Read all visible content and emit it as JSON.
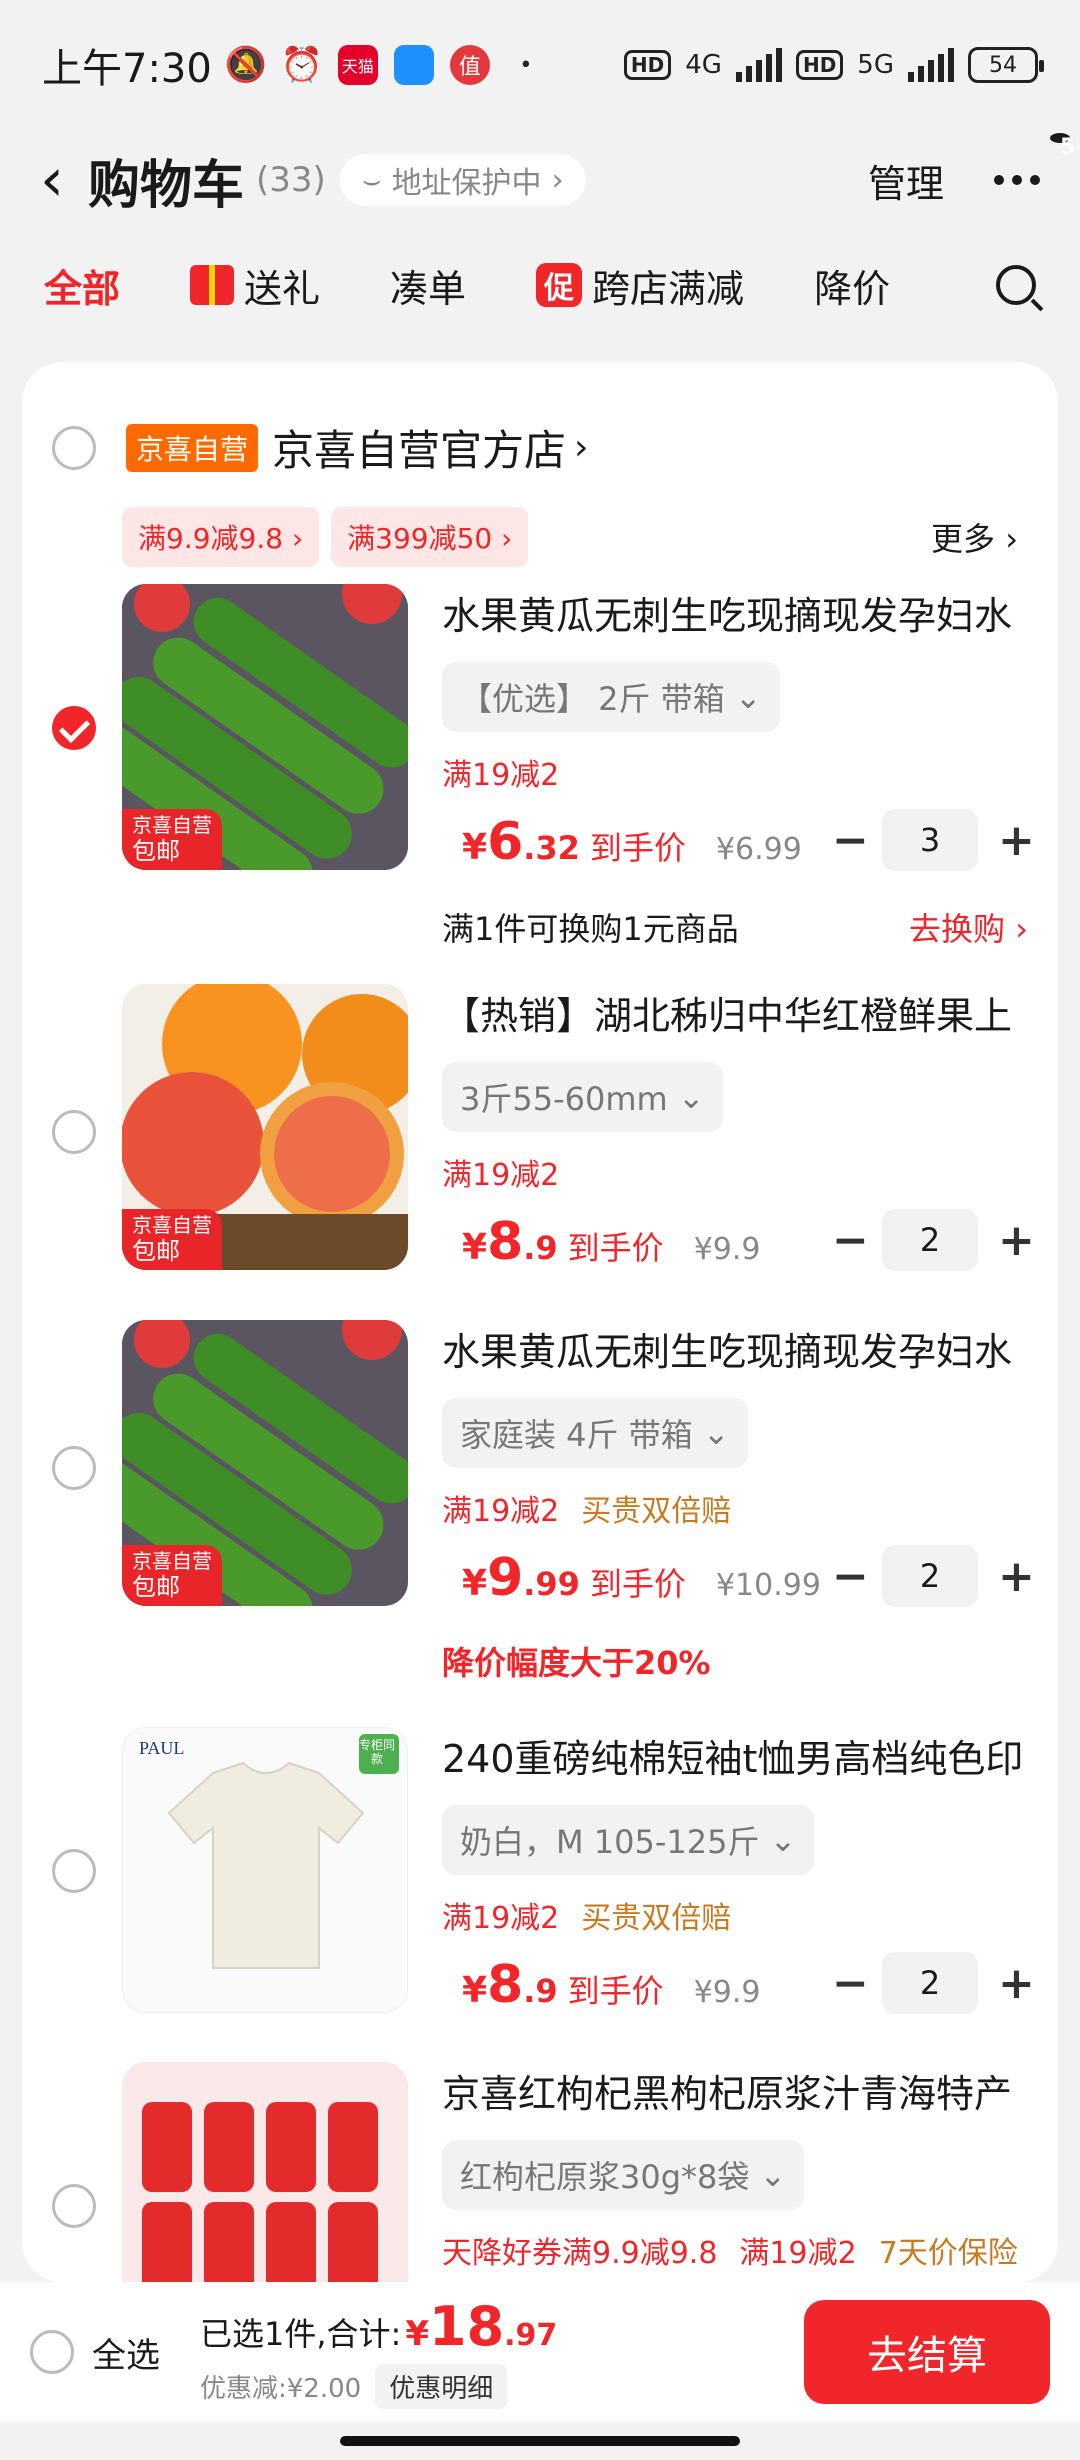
{
  "status_bar": {
    "time": "上午7:30",
    "net1": "4G",
    "net2": "5G",
    "hd": "HD",
    "battery": "54",
    "app_icon_1": "天猫",
    "app_icon_3": "值"
  },
  "header": {
    "title": "购物车",
    "count": "(33)",
    "address_pill": "地址保护中",
    "manage": "管理",
    "badge": "5+"
  },
  "tabs": [
    "全部",
    "送礼",
    "凑单",
    "跨店满减",
    "降价"
  ],
  "tab_icons": {
    "promo_mark": "促"
  },
  "store": {
    "tag": "京喜自营",
    "name": "京喜自营官方店",
    "promos": [
      "满9.9减9.8 ›",
      "满399减50 ›"
    ],
    "more": "更多 ›"
  },
  "items": [
    {
      "name": "水果黄瓜无刺生吃现摘现发孕妇水",
      "spec": "【优选】 2斤 带箱",
      "tags": [
        "满19减2"
      ],
      "price_int": "6",
      "price_dec": ".32",
      "dao": "到手价",
      "orig": "¥6.99",
      "qty": "3",
      "checked": true,
      "thumb_label_1": "京喜自营",
      "thumb_label_2": "包邮",
      "exchange_text": "满1件可换购1元商品",
      "exchange_link": "去换购 ›"
    },
    {
      "name": "【热销】湖北秭归中华红橙鲜果上",
      "spec": "3斤55-60mm",
      "tags": [
        "满19减2"
      ],
      "price_int": "8",
      "price_dec": ".9",
      "dao": "到手价",
      "orig": "¥9.9",
      "qty": "2",
      "checked": false,
      "thumb_label_1": "京喜自营",
      "thumb_label_2": "包邮"
    },
    {
      "name": "水果黄瓜无刺生吃现摘现发孕妇水",
      "spec": "家庭装 4斤 带箱",
      "tags": [
        "满19减2",
        "买贵双倍赔"
      ],
      "price_int": "9",
      "price_dec": ".99",
      "dao": "到手价",
      "orig": "¥10.99",
      "qty": "2",
      "checked": false,
      "thumb_label_1": "京喜自营",
      "thumb_label_2": "包邮",
      "drop_text": "降价幅度大于20%"
    },
    {
      "name": "240重磅纯棉短袖t恤男高档纯色印",
      "spec": "奶白，M 105-125斤",
      "tags": [
        "满19减2",
        "买贵双倍赔"
      ],
      "price_int": "8",
      "price_dec": ".9",
      "dao": "到手价",
      "orig": "¥9.9",
      "qty": "2",
      "checked": false,
      "brand": "PAUL",
      "corner": "专柜同款"
    },
    {
      "name": "京喜红枸杞黑枸杞原浆汁青海特产",
      "spec": "红枸杞原浆30g*8袋",
      "tags": [
        "天降好券满9.9减9.8",
        "满19减2",
        "7天价保险"
      ],
      "checked": false
    }
  ],
  "bottom": {
    "select_all": "全选",
    "selected_text": "已选1件,合计:",
    "yen": "¥",
    "total_int": "18",
    "total_dec": ".97",
    "discount": "优惠减:¥2.00",
    "detail_button": "优惠明细",
    "checkout": "去结算"
  },
  "colors": {
    "accent": "#f0262a",
    "orange_tag": "#ff6a00",
    "background": "#f2f2f2"
  }
}
